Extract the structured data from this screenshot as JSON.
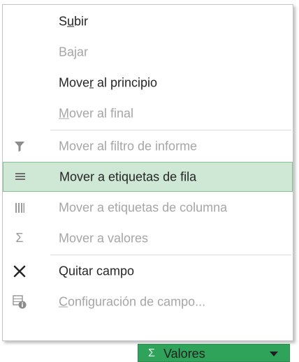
{
  "menu": {
    "items": [
      {
        "label": "Subir",
        "mnemonic": "u",
        "enabled": true
      },
      {
        "label": "Bajar",
        "mnemonic": "j",
        "enabled": false
      },
      {
        "label": "Mover al principio",
        "mnemonic": "r",
        "enabled": true
      },
      {
        "label": "Mover al final",
        "mnemonic": "M",
        "enabled": false
      },
      {
        "label": "Mover al filtro de informe",
        "icon": "filter-icon",
        "enabled": false
      },
      {
        "label": "Mover a etiquetas de fila",
        "icon": "rows-icon",
        "enabled": true,
        "highlighted": true
      },
      {
        "label": "Mover a etiquetas de columna",
        "icon": "columns-icon",
        "enabled": false
      },
      {
        "label": "Mover a valores",
        "icon": "sigma-icon",
        "enabled": false
      },
      {
        "label": "Quitar campo",
        "icon": "remove-x-icon",
        "enabled": true
      },
      {
        "label": "Configuración de campo...",
        "mnemonic": "C",
        "icon": "field-settings-icon",
        "enabled": false
      }
    ]
  },
  "field_button": {
    "sigma": "Σ",
    "label": "Valores",
    "icon": "dropdown-arrow-icon"
  },
  "colors": {
    "highlight_bg": "#cfe8d5",
    "highlight_border": "#86bf97",
    "field_button_bg": "#2fa35a",
    "disabled_text": "#a6a6a6"
  }
}
